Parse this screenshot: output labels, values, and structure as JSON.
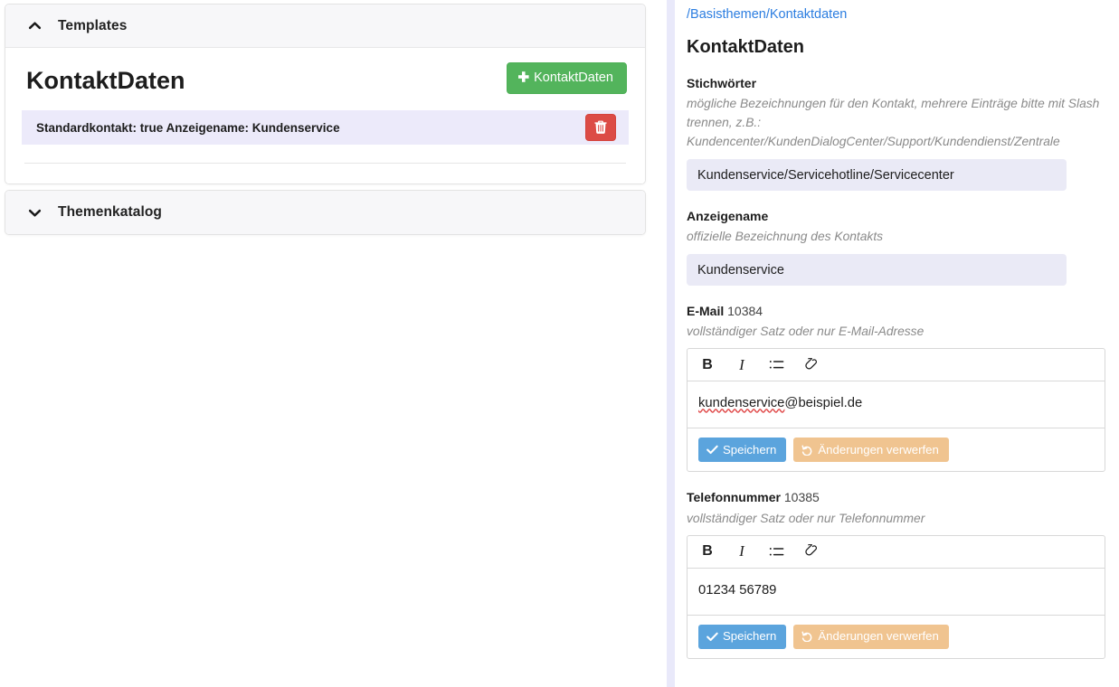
{
  "left_panel": {
    "accordions": [
      {
        "label": "Templates",
        "state": "expanded",
        "icon": "chevron-up-icon"
      },
      {
        "label": "Themenkatalog",
        "state": "collapsed",
        "icon": "chevron-down-icon"
      }
    ],
    "templates_section": {
      "title": "KontaktDaten",
      "add_button": {
        "label": "KontaktDaten",
        "icon": "plus-icon",
        "color": "#53b45c"
      },
      "items": [
        {
          "label": "Standardkontakt: true Anzeigename: Kundenservice",
          "delete_icon": "trash-icon",
          "delete_color": "#dc4c46",
          "row_background": "#eceafa"
        }
      ]
    }
  },
  "right_panel": {
    "breadcrumb": "/Basisthemen/Kontaktdaten",
    "breadcrumb_color": "#2b7de0",
    "title": "KontaktDaten",
    "fields": [
      {
        "label": "Stichwörter",
        "id": "",
        "hint": "mögliche Bezeichnungen für den Kontakt, mehrere Einträge bitte mit Slash trennen, z.B.:\nKundencenter/KundenDialogCenter/Support/Kundendienst/Zentrale",
        "type": "text",
        "value": "Kundenservice/Servicehotline/Servicecenter",
        "placeholder": ""
      },
      {
        "label": "Anzeigename",
        "id": "",
        "hint": "offizielle Bezeichnung des Kontakts",
        "type": "text",
        "value": "Kundenservice",
        "placeholder": ""
      },
      {
        "label": "E-Mail",
        "id": "10384",
        "hint": "vollständiger Satz oder nur E-Mail-Adresse",
        "type": "richtext",
        "value_prefix": "kundenservice",
        "value_suffix": "@beispiel.de",
        "value": "kundenservice@beispiel.de",
        "spellcheck_word": "kundenservice"
      },
      {
        "label": "Telefonnummer",
        "id": "10385",
        "hint": "vollständiger Satz oder nur Telefonnummer",
        "type": "richtext",
        "value": "01234 56789",
        "spellcheck_word": ""
      }
    ],
    "editor_toolbar": [
      {
        "name": "bold-icon",
        "glyph": "B"
      },
      {
        "name": "italic-icon",
        "glyph": "I"
      },
      {
        "name": "list-icon",
        "glyph": ""
      },
      {
        "name": "link-icon",
        "glyph": ""
      }
    ],
    "editor_buttons": {
      "save_label": "Speichern",
      "save_icon": "check-icon",
      "save_color": "#5ba4dd",
      "discard_label": "Änderungen verwerfen",
      "discard_icon": "undo-icon",
      "discard_color": "#f0c490"
    }
  }
}
